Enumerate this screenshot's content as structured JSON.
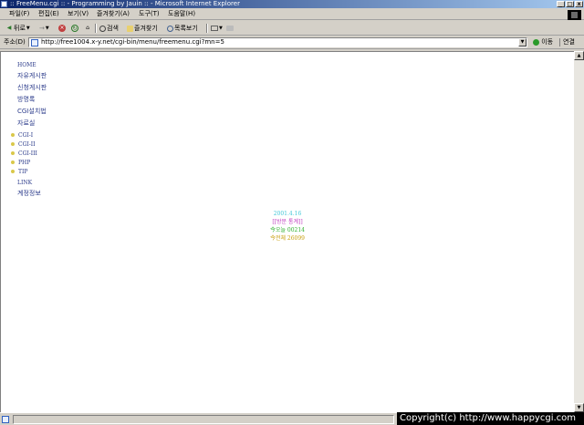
{
  "window": {
    "title": ":: FreeMenu.cgi :: - Programming by Jauin :: - Microsoft Internet Explorer",
    "buttons": [
      "_",
      "□",
      "x"
    ]
  },
  "menubar": {
    "file": "파일(F)",
    "edit": "편집(E)",
    "view": "보기(V)",
    "favorites": "즐겨찾기(A)",
    "tools": "도구(T)",
    "help": "도움말(H)"
  },
  "toolbar": {
    "back": "뒤로",
    "forward_arrow": "→",
    "search": "검색",
    "favorites": "즐겨찾기",
    "history": "목록보기"
  },
  "addressbar": {
    "label": "주소(D)",
    "url": "http://free1004.x-y.net/cgi-bin/menu/freemenu.cgi?mn=5",
    "go": "이동",
    "links": "연결"
  },
  "menu": {
    "items": [
      {
        "label": "HOME"
      },
      {
        "label": "자유게시판"
      },
      {
        "label": "신청게시판"
      },
      {
        "label": "방명록"
      },
      {
        "label": "CGI설치법"
      },
      {
        "label": "자료실"
      },
      {
        "label": "CGI-I"
      },
      {
        "label": "CGI-II"
      },
      {
        "label": "CGI-III"
      },
      {
        "label": "PHP"
      },
      {
        "label": "TIP"
      },
      {
        "label": "LINK"
      },
      {
        "label": "계정정보"
      }
    ]
  },
  "stats": {
    "date": "2001.4.16",
    "title": "[[방문 통계]]",
    "today": "今오늘 00214",
    "total": "今전체 26099"
  },
  "colors": {
    "menu_text": "#2a3a8a",
    "bullet": "#d9c84a",
    "stats_date": "#44c8d8",
    "stats_title": "#c040c0",
    "stats_today": "#30b030",
    "stats_total": "#c8a010"
  },
  "overlay": {
    "copyright": "Copyright(c) http://www.happycgi.com"
  }
}
